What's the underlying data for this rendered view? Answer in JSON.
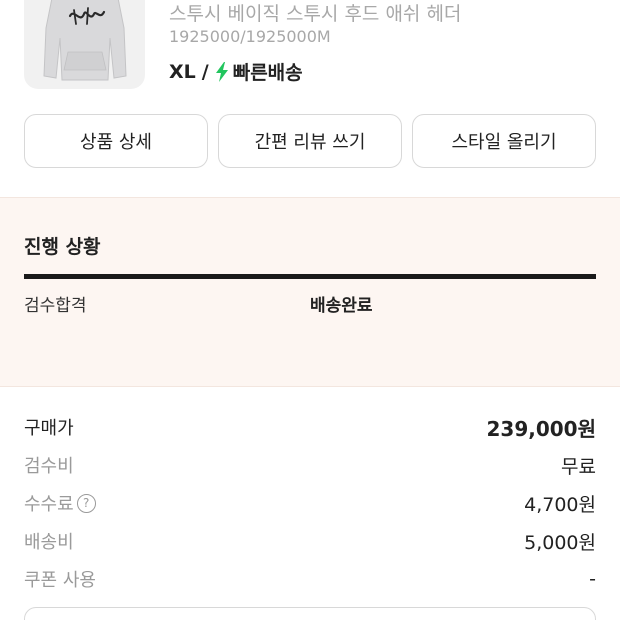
{
  "product": {
    "name": "스투시 베이직 스투시 후드 애쉬 헤더",
    "code": "1925000/1925000M",
    "size": "XL",
    "slash": "/",
    "delivery": "빠른배송",
    "thumb_alt": "hoodie"
  },
  "actions": {
    "detail": "상품 상세",
    "review": "간편 리뷰 쓰기",
    "style": "스타일 올리기"
  },
  "progress": {
    "title": "진행 상황",
    "step_done": "검수합격",
    "step_current": "배송완료"
  },
  "summary": {
    "purchase_label": "구매가",
    "purchase_value": "239,000원",
    "inspection_label": "검수비",
    "inspection_value": "무료",
    "fee_label": "수수료",
    "fee_help": "?",
    "fee_value": "4,700원",
    "shipping_label": "배송비",
    "shipping_value": "5,000원",
    "coupon_label": "쿠폰 사용",
    "coupon_value": "-"
  },
  "colors": {
    "accent_green": "#22c55e",
    "progress_bg": "#fdf6f2"
  }
}
